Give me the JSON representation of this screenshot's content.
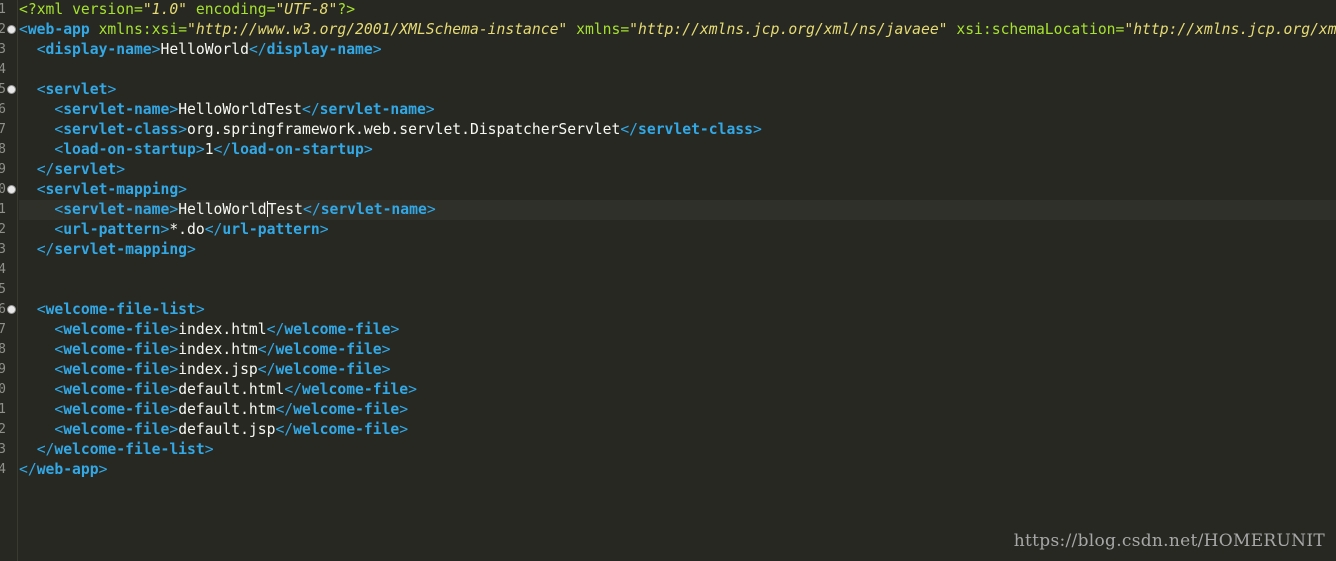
{
  "editor": {
    "line_numbers": [
      "1",
      "2",
      "3",
      "4",
      "5",
      "6",
      "7",
      "8",
      "9",
      "0",
      "1",
      "2",
      "3",
      "4",
      "5",
      "6",
      "7",
      "8",
      "9",
      "0",
      "1",
      "2",
      "3",
      "4"
    ],
    "fold_lines": [
      2,
      5,
      10,
      16
    ],
    "current_line": 11,
    "lines": [
      [
        {
          "t": "decl",
          "v": "<?"
        },
        {
          "t": "attr",
          "v": "xml"
        },
        {
          "t": "text",
          "v": " "
        },
        {
          "t": "attr",
          "v": "version"
        },
        {
          "t": "eq",
          "v": "="
        },
        {
          "t": "val",
          "v": "\"1.0\""
        },
        {
          "t": "text",
          "v": " "
        },
        {
          "t": "attr",
          "v": "encoding"
        },
        {
          "t": "eq",
          "v": "="
        },
        {
          "t": "val",
          "v": "\"UTF-8\""
        },
        {
          "t": "decl",
          "v": "?>"
        }
      ],
      [
        {
          "t": "punc",
          "v": "<"
        },
        {
          "t": "tag",
          "v": "web-app"
        },
        {
          "t": "text",
          "v": " "
        },
        {
          "t": "attr",
          "v": "xmlns:xsi"
        },
        {
          "t": "eq",
          "v": "="
        },
        {
          "t": "val",
          "v": "\"http://www.w3.org/2001/XMLSchema-instance\""
        },
        {
          "t": "text",
          "v": " "
        },
        {
          "t": "attr",
          "v": "xmlns"
        },
        {
          "t": "eq",
          "v": "="
        },
        {
          "t": "val",
          "v": "\"http://xmlns.jcp.org/xml/ns/javaee\""
        },
        {
          "t": "text",
          "v": " "
        },
        {
          "t": "attr",
          "v": "xsi:schemaLocation"
        },
        {
          "t": "eq",
          "v": "="
        },
        {
          "t": "val",
          "v": "\"http://xmlns.jcp.org/xml/ns/javaee"
        }
      ],
      [
        {
          "t": "text",
          "v": "  "
        },
        {
          "t": "punc",
          "v": "<"
        },
        {
          "t": "tag",
          "v": "display-name"
        },
        {
          "t": "punc",
          "v": ">"
        },
        {
          "t": "text",
          "v": "HelloWorld"
        },
        {
          "t": "punc",
          "v": "</"
        },
        {
          "t": "tag",
          "v": "display-name"
        },
        {
          "t": "punc",
          "v": ">"
        }
      ],
      [],
      [
        {
          "t": "text",
          "v": "  "
        },
        {
          "t": "punc",
          "v": "<"
        },
        {
          "t": "tag",
          "v": "servlet"
        },
        {
          "t": "punc",
          "v": ">"
        }
      ],
      [
        {
          "t": "text",
          "v": "    "
        },
        {
          "t": "punc",
          "v": "<"
        },
        {
          "t": "tag",
          "v": "servlet-name"
        },
        {
          "t": "punc",
          "v": ">"
        },
        {
          "t": "text",
          "v": "HelloWorldTest"
        },
        {
          "t": "punc",
          "v": "</"
        },
        {
          "t": "tag",
          "v": "servlet-name"
        },
        {
          "t": "punc",
          "v": ">"
        }
      ],
      [
        {
          "t": "text",
          "v": "    "
        },
        {
          "t": "punc",
          "v": "<"
        },
        {
          "t": "tag",
          "v": "servlet-class"
        },
        {
          "t": "punc",
          "v": ">"
        },
        {
          "t": "text",
          "v": "org.springframework.web.servlet.DispatcherServlet"
        },
        {
          "t": "punc",
          "v": "</"
        },
        {
          "t": "tag",
          "v": "servlet-class"
        },
        {
          "t": "punc",
          "v": ">"
        }
      ],
      [
        {
          "t": "text",
          "v": "    "
        },
        {
          "t": "punc",
          "v": "<"
        },
        {
          "t": "tag",
          "v": "load-on-startup"
        },
        {
          "t": "punc",
          "v": ">"
        },
        {
          "t": "text",
          "v": "1"
        },
        {
          "t": "punc",
          "v": "</"
        },
        {
          "t": "tag",
          "v": "load-on-startup"
        },
        {
          "t": "punc",
          "v": ">"
        }
      ],
      [
        {
          "t": "text",
          "v": "  "
        },
        {
          "t": "punc",
          "v": "</"
        },
        {
          "t": "tag",
          "v": "servlet"
        },
        {
          "t": "punc",
          "v": ">"
        }
      ],
      [
        {
          "t": "text",
          "v": "  "
        },
        {
          "t": "punc",
          "v": "<"
        },
        {
          "t": "tag",
          "v": "servlet-mapping"
        },
        {
          "t": "punc",
          "v": ">"
        }
      ],
      [
        {
          "t": "text",
          "v": "    "
        },
        {
          "t": "punc",
          "v": "<"
        },
        {
          "t": "tag",
          "v": "servlet-name"
        },
        {
          "t": "punc",
          "v": ">"
        },
        {
          "t": "text",
          "v": "HelloWorld"
        },
        {
          "t": "caret",
          "v": ""
        },
        {
          "t": "text",
          "v": "Test"
        },
        {
          "t": "punc",
          "v": "</"
        },
        {
          "t": "tag",
          "v": "servlet-name"
        },
        {
          "t": "punc",
          "v": ">"
        }
      ],
      [
        {
          "t": "text",
          "v": "    "
        },
        {
          "t": "punc",
          "v": "<"
        },
        {
          "t": "tag",
          "v": "url-pattern"
        },
        {
          "t": "punc",
          "v": ">"
        },
        {
          "t": "text",
          "v": "*.do"
        },
        {
          "t": "punc",
          "v": "</"
        },
        {
          "t": "tag",
          "v": "url-pattern"
        },
        {
          "t": "punc",
          "v": ">"
        }
      ],
      [
        {
          "t": "text",
          "v": "  "
        },
        {
          "t": "punc",
          "v": "</"
        },
        {
          "t": "tag",
          "v": "servlet-mapping"
        },
        {
          "t": "punc",
          "v": ">"
        }
      ],
      [],
      [],
      [
        {
          "t": "text",
          "v": "  "
        },
        {
          "t": "punc",
          "v": "<"
        },
        {
          "t": "tag",
          "v": "welcome-file-list"
        },
        {
          "t": "punc",
          "v": ">"
        }
      ],
      [
        {
          "t": "text",
          "v": "    "
        },
        {
          "t": "punc",
          "v": "<"
        },
        {
          "t": "tag",
          "v": "welcome-file"
        },
        {
          "t": "punc",
          "v": ">"
        },
        {
          "t": "text",
          "v": "index.html"
        },
        {
          "t": "punc",
          "v": "</"
        },
        {
          "t": "tag",
          "v": "welcome-file"
        },
        {
          "t": "punc",
          "v": ">"
        }
      ],
      [
        {
          "t": "text",
          "v": "    "
        },
        {
          "t": "punc",
          "v": "<"
        },
        {
          "t": "tag",
          "v": "welcome-file"
        },
        {
          "t": "punc",
          "v": ">"
        },
        {
          "t": "text",
          "v": "index.htm"
        },
        {
          "t": "punc",
          "v": "</"
        },
        {
          "t": "tag",
          "v": "welcome-file"
        },
        {
          "t": "punc",
          "v": ">"
        }
      ],
      [
        {
          "t": "text",
          "v": "    "
        },
        {
          "t": "punc",
          "v": "<"
        },
        {
          "t": "tag",
          "v": "welcome-file"
        },
        {
          "t": "punc",
          "v": ">"
        },
        {
          "t": "text",
          "v": "index.jsp"
        },
        {
          "t": "punc",
          "v": "</"
        },
        {
          "t": "tag",
          "v": "welcome-file"
        },
        {
          "t": "punc",
          "v": ">"
        }
      ],
      [
        {
          "t": "text",
          "v": "    "
        },
        {
          "t": "punc",
          "v": "<"
        },
        {
          "t": "tag",
          "v": "welcome-file"
        },
        {
          "t": "punc",
          "v": ">"
        },
        {
          "t": "text",
          "v": "default.html"
        },
        {
          "t": "punc",
          "v": "</"
        },
        {
          "t": "tag",
          "v": "welcome-file"
        },
        {
          "t": "punc",
          "v": ">"
        }
      ],
      [
        {
          "t": "text",
          "v": "    "
        },
        {
          "t": "punc",
          "v": "<"
        },
        {
          "t": "tag",
          "v": "welcome-file"
        },
        {
          "t": "punc",
          "v": ">"
        },
        {
          "t": "text",
          "v": "default.htm"
        },
        {
          "t": "punc",
          "v": "</"
        },
        {
          "t": "tag",
          "v": "welcome-file"
        },
        {
          "t": "punc",
          "v": ">"
        }
      ],
      [
        {
          "t": "text",
          "v": "    "
        },
        {
          "t": "punc",
          "v": "<"
        },
        {
          "t": "tag",
          "v": "welcome-file"
        },
        {
          "t": "punc",
          "v": ">"
        },
        {
          "t": "text",
          "v": "default.jsp"
        },
        {
          "t": "punc",
          "v": "</"
        },
        {
          "t": "tag",
          "v": "welcome-file"
        },
        {
          "t": "punc",
          "v": ">"
        }
      ],
      [
        {
          "t": "text",
          "v": "  "
        },
        {
          "t": "punc",
          "v": "</"
        },
        {
          "t": "tag",
          "v": "welcome-file-list"
        },
        {
          "t": "punc",
          "v": ">"
        }
      ],
      [
        {
          "t": "punc",
          "v": "</"
        },
        {
          "t": "tag",
          "v": "web-app"
        },
        {
          "t": "punc",
          "v": ">"
        }
      ]
    ]
  },
  "watermark": {
    "text": "https://blog.csdn.net/HOMERUNIT"
  },
  "colors": {
    "background": "#272822",
    "tag": "#32a8e6",
    "attribute": "#a6e22e",
    "string": "#e6db74",
    "text": "#f8f8f2",
    "line_number": "#8f908a",
    "watermark": "#a7a7a7"
  }
}
